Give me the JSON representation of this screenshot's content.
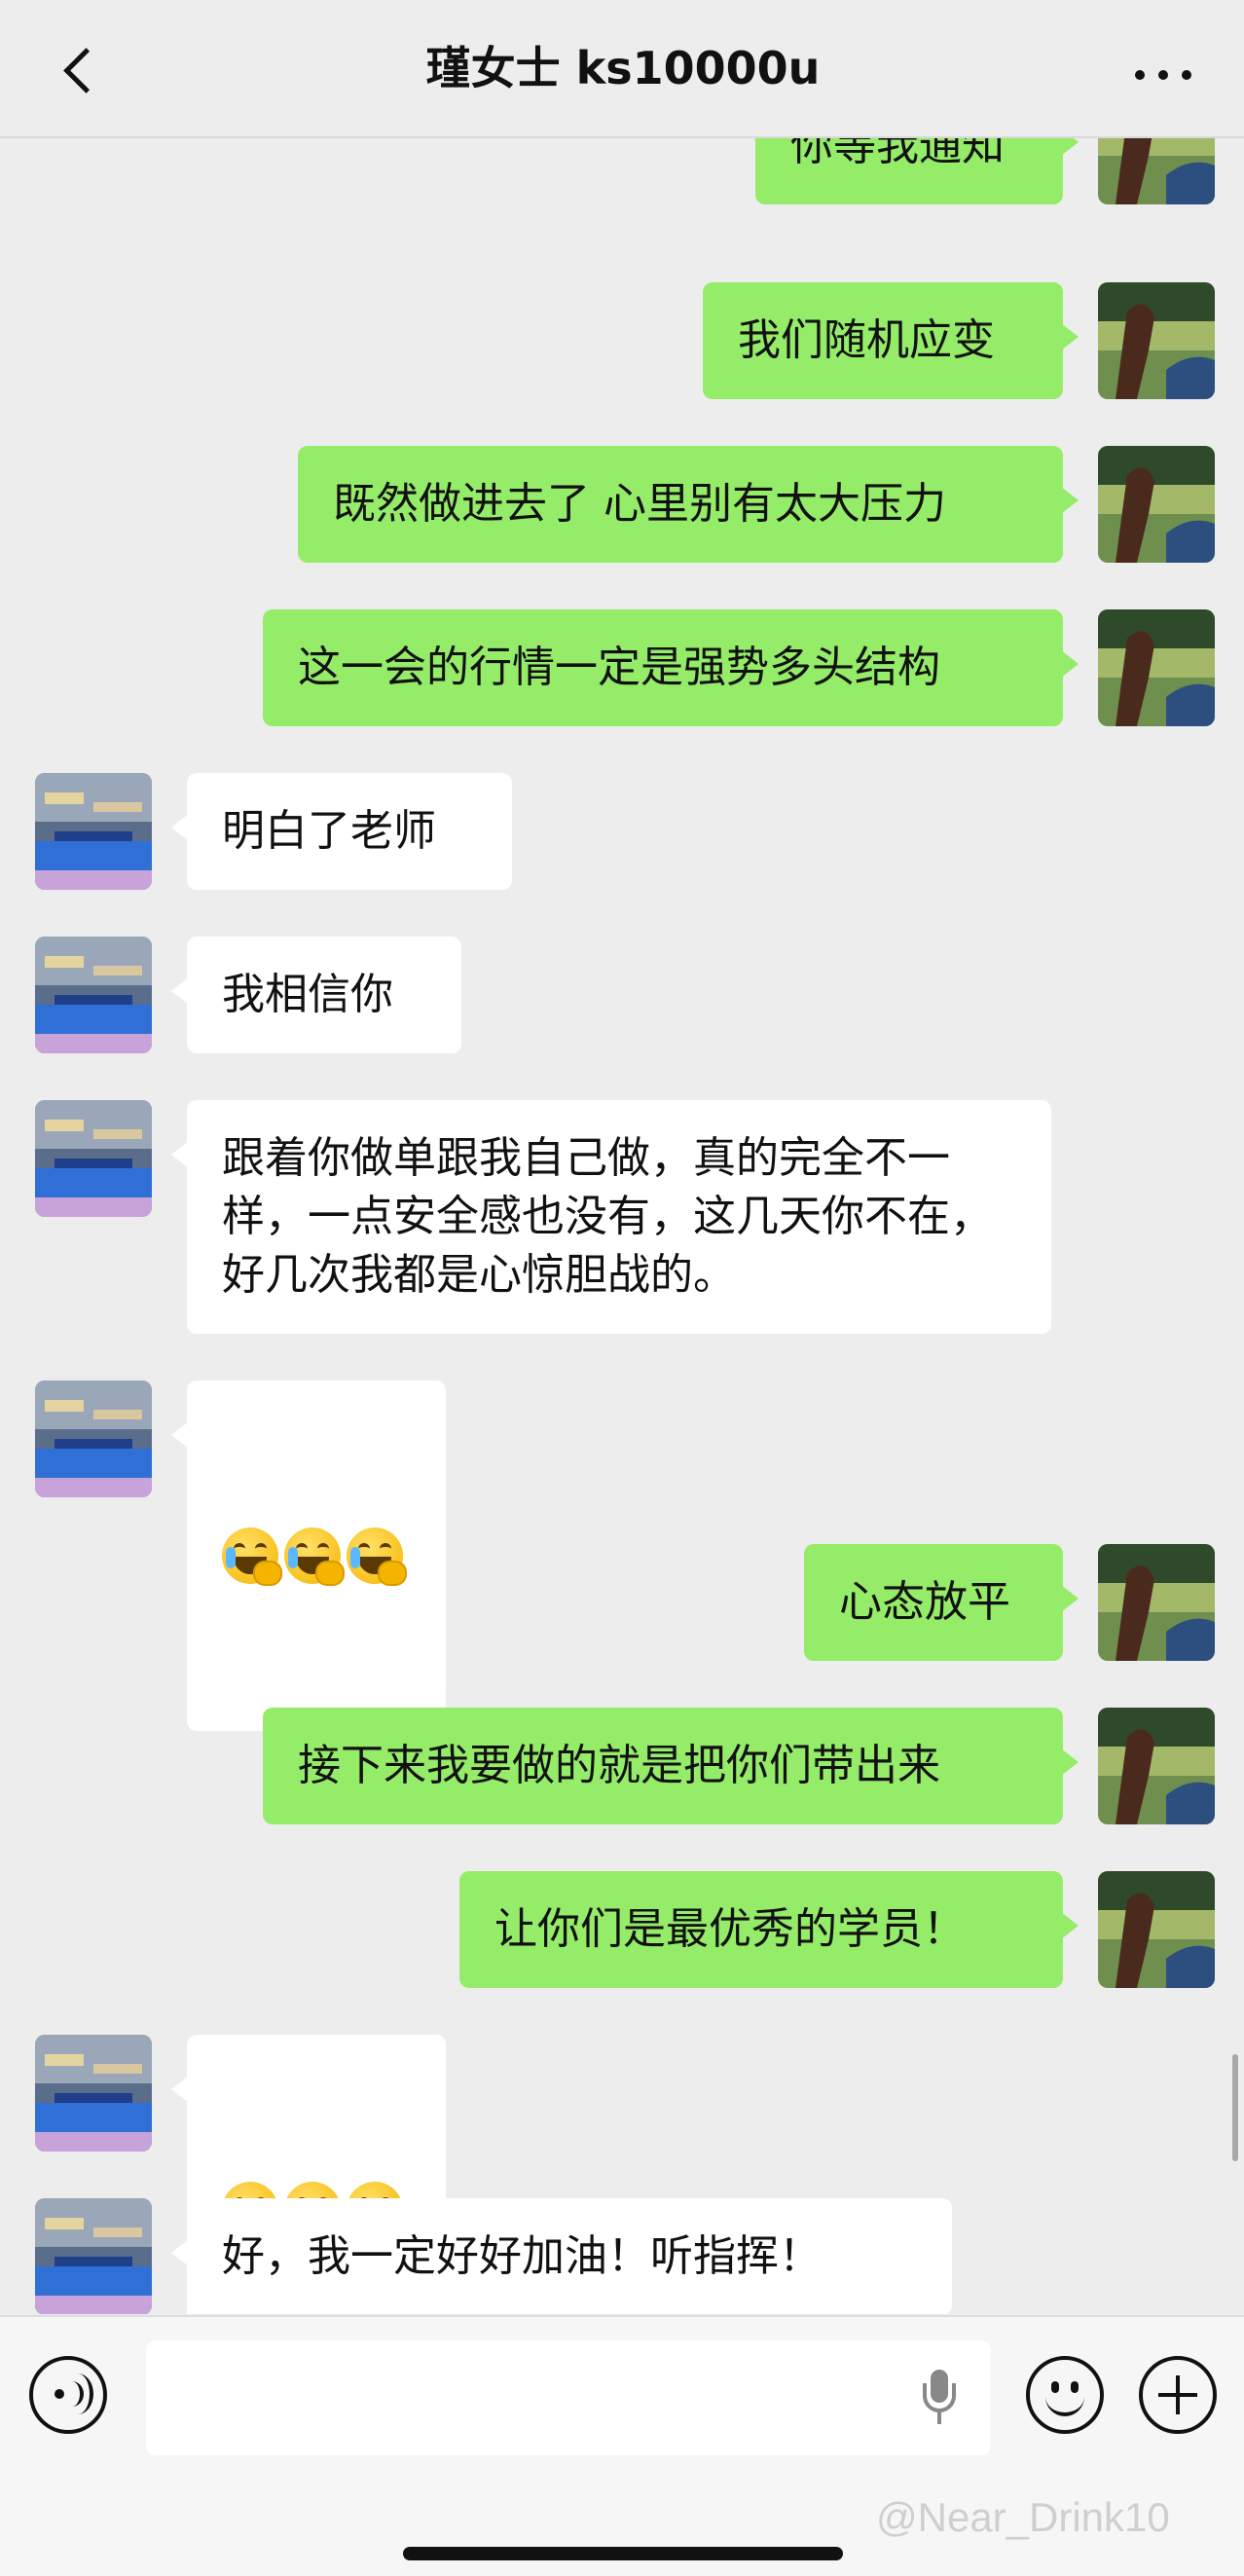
{
  "header": {
    "title": "瑾女士 ks10000u",
    "back_icon": "chevron-left-icon",
    "more_icon": "more-dots-icon"
  },
  "colors": {
    "my_bubble": "#95ec69",
    "peer_bubble": "#ffffff",
    "background": "#ededed"
  },
  "messages": [
    {
      "sender": "me",
      "text": "你等我通知"
    },
    {
      "sender": "me",
      "text": "我们随机应变"
    },
    {
      "sender": "me",
      "text": "既然做进去了 心里别有太大压力"
    },
    {
      "sender": "me",
      "text": "这一会的行情一定是强势多头结构"
    },
    {
      "sender": "peer",
      "text": "明白了老师"
    },
    {
      "sender": "peer",
      "text": "我相信你"
    },
    {
      "sender": "peer",
      "text": "跟着你做单跟我自己做，真的完全不一样，一点安全感也没有，这几天你不在，好几次我都是心惊胆战的。"
    },
    {
      "sender": "peer",
      "emoji": [
        "crying-emoji",
        "crying-emoji",
        "crying-emoji"
      ]
    },
    {
      "sender": "me",
      "text": "心态放平"
    },
    {
      "sender": "me",
      "text": "接下来我要做的就是把你们带出来"
    },
    {
      "sender": "me",
      "text": "让你们是最优秀的学员！"
    },
    {
      "sender": "peer",
      "emoji": [
        "grinning-emoji",
        "grinning-emoji",
        "grinning-emoji"
      ]
    },
    {
      "sender": "peer",
      "text": "好，我一定好好加油！听指挥！"
    }
  ],
  "input_bar": {
    "voice_icon": "voice-icon",
    "mic_icon": "microphone-icon",
    "emoji_icon": "smiley-icon",
    "plus_icon": "plus-icon",
    "text_value": ""
  },
  "watermark": "@Near_Drink10"
}
